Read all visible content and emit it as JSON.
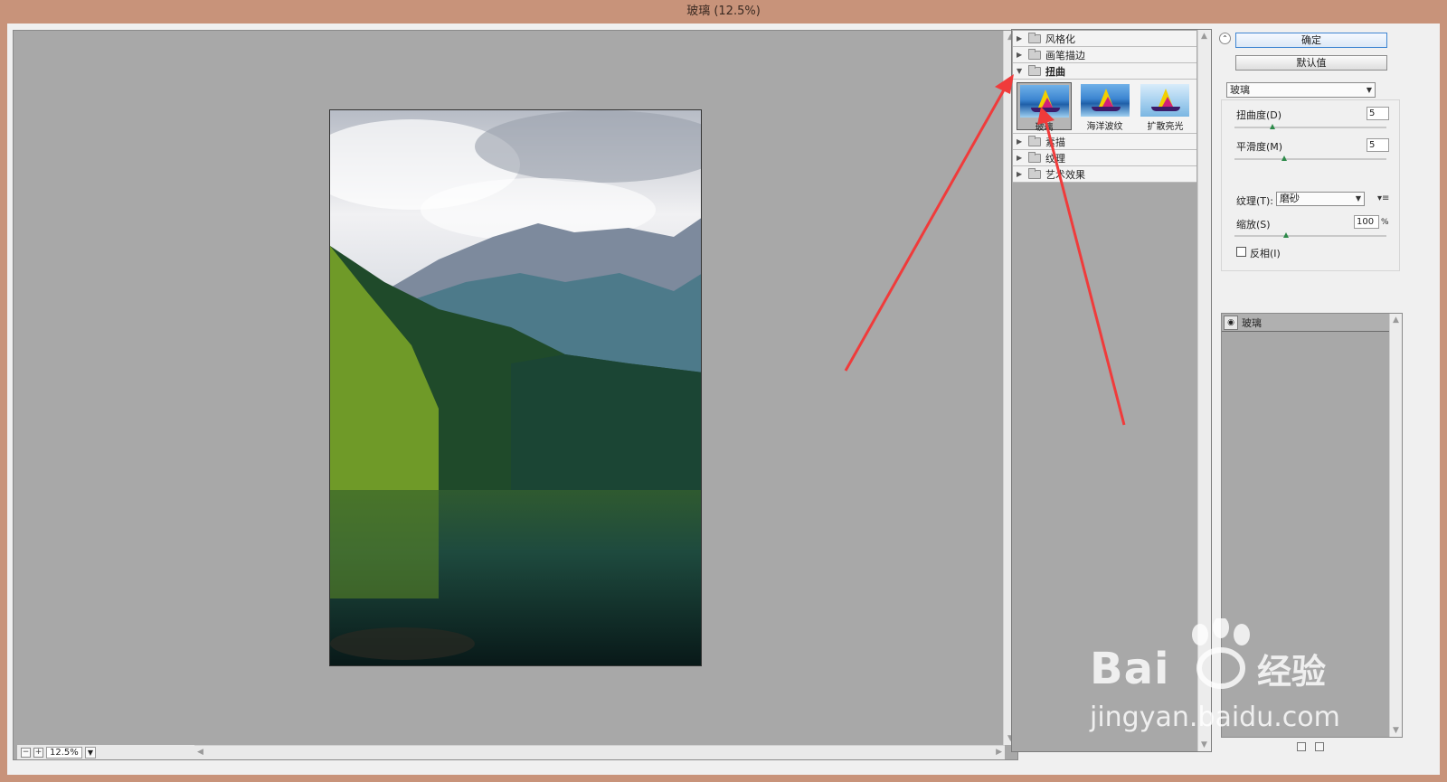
{
  "window": {
    "title": "玻璃 (12.5%)"
  },
  "preview": {
    "zoom": "12.5%"
  },
  "gallery": {
    "categories_top": [
      {
        "label": "风格化",
        "open": false
      },
      {
        "label": "画笔描边",
        "open": false
      },
      {
        "label": "扭曲",
        "open": true
      }
    ],
    "thumbnails": [
      {
        "label": "玻璃",
        "selected": true
      },
      {
        "label": "海洋波纹",
        "selected": false
      },
      {
        "label": "扩散亮光",
        "selected": false
      }
    ],
    "categories_bottom": [
      {
        "label": "素描",
        "open": false
      },
      {
        "label": "纹理",
        "open": false
      },
      {
        "label": "艺术效果",
        "open": false
      }
    ]
  },
  "settings": {
    "ok_label": "确定",
    "default_label": "默认值",
    "filter_value": "玻璃",
    "distortion_label": "扭曲度(D)",
    "distortion_value": "5",
    "distortion_level": 0.25,
    "smoothness_label": "平滑度(M)",
    "smoothness_value": "5",
    "smoothness_level": 0.33,
    "texture_label": "纹理(T):",
    "texture_value": "磨砂",
    "scale_label": "缩放(S)",
    "scale_value": "100",
    "scale_unit": "%",
    "scale_level": 0.34,
    "invert_label": "反相(I)",
    "invert_checked": false
  },
  "layers": {
    "layer_name": "玻璃"
  },
  "watermark": {
    "logo": "Bai",
    "logo_suffix": "经验",
    "url": "jingyan.baidu.com"
  },
  "colors": {
    "annotation_arrow": "#f03b3b",
    "title_bar": "#c8937a",
    "panel_gray": "#a8a8a8"
  }
}
